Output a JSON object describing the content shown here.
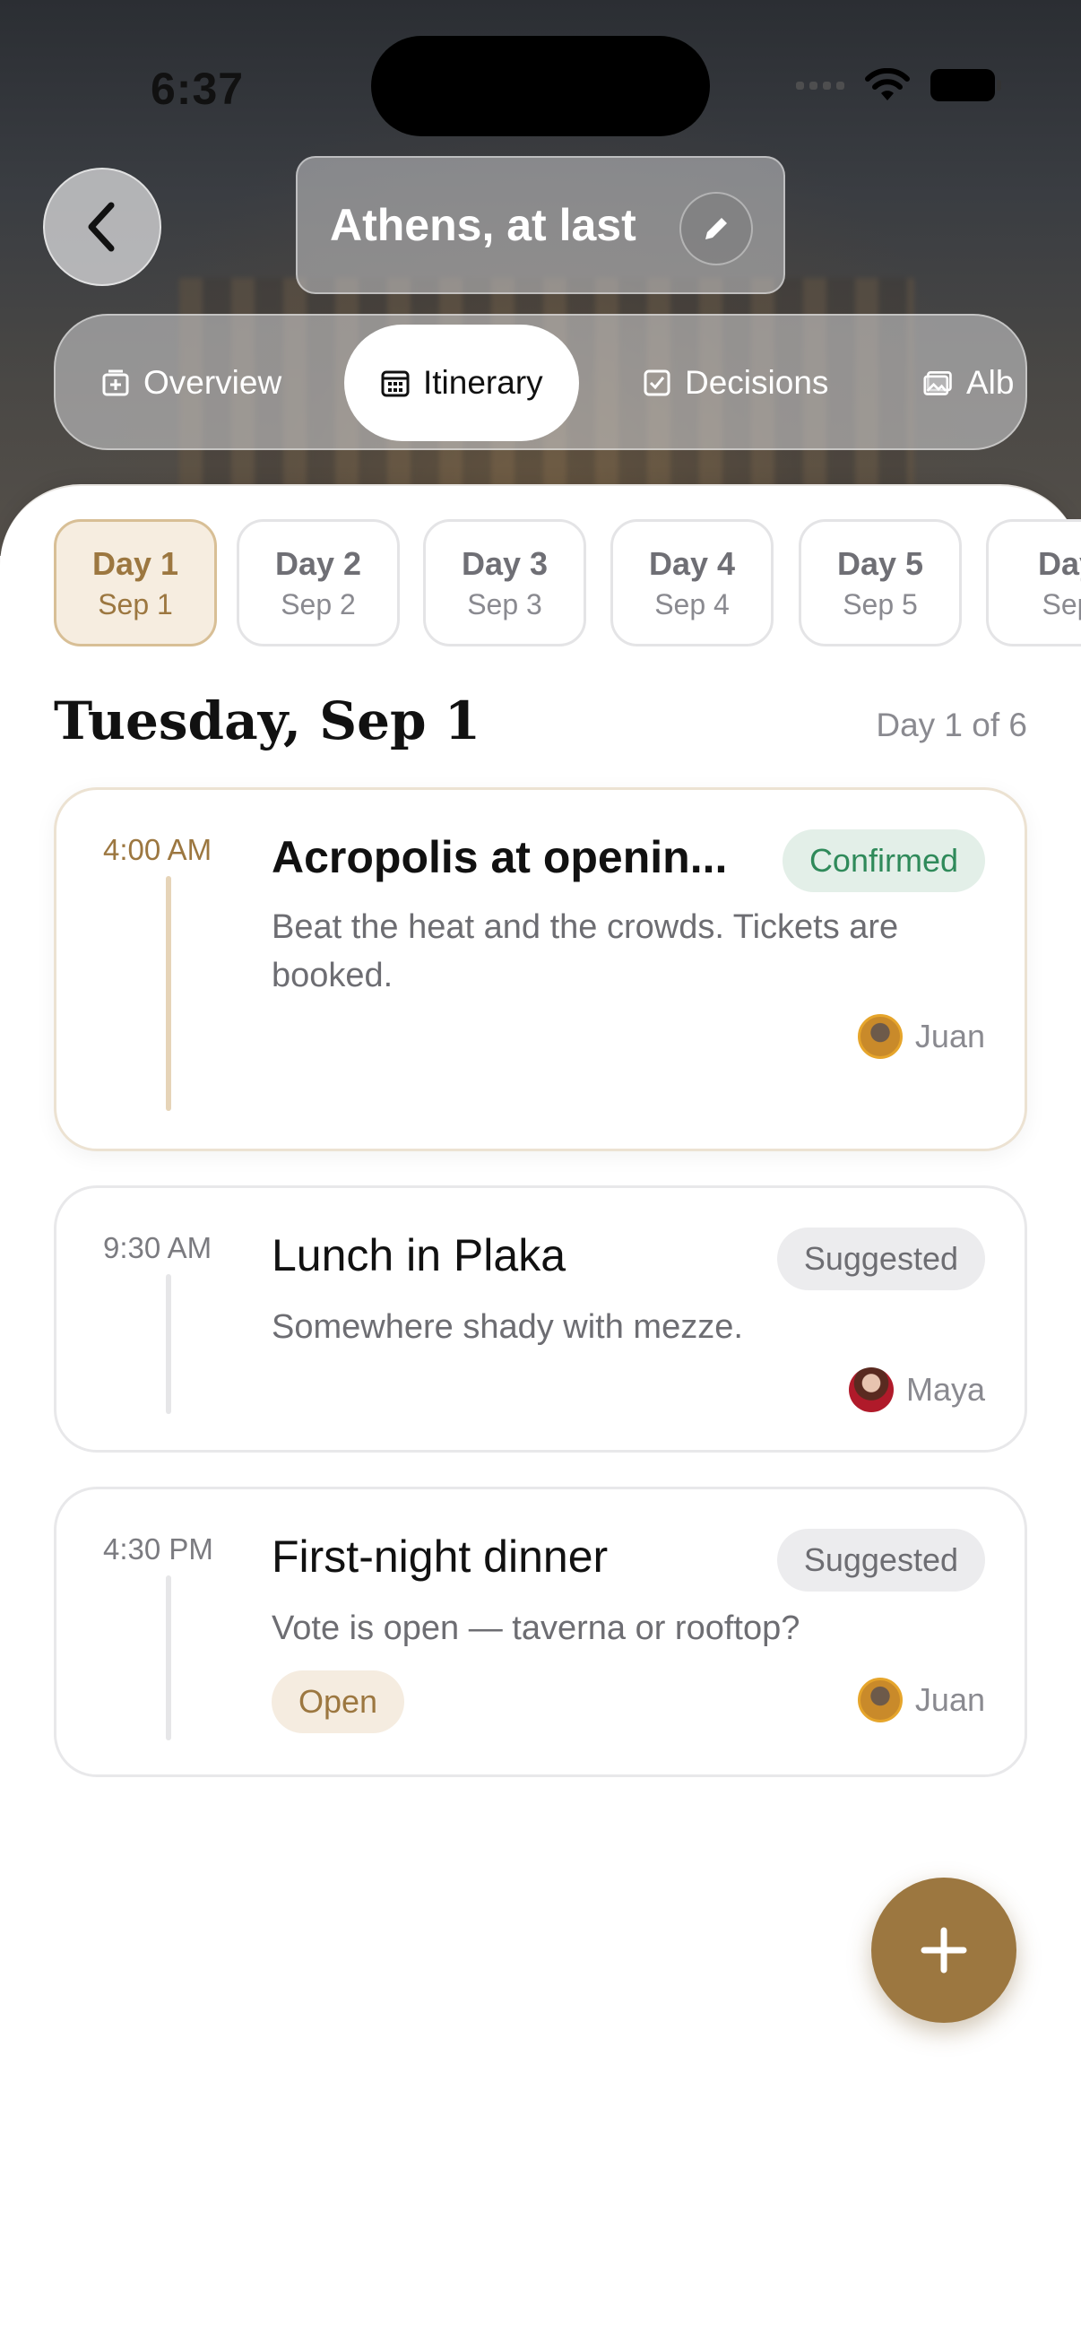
{
  "status_bar": {
    "time": "6:37"
  },
  "header": {
    "title": "Athens, at last"
  },
  "tabs": [
    {
      "label": "Overview",
      "icon": "overview-icon"
    },
    {
      "label": "Itinerary",
      "icon": "calendar-icon",
      "active": true
    },
    {
      "label": "Decisions",
      "icon": "checkbox-icon"
    },
    {
      "label": "Alb",
      "icon": "album-icon"
    }
  ],
  "days": [
    {
      "label": "Day 1",
      "date": "Sep 1",
      "active": true
    },
    {
      "label": "Day 2",
      "date": "Sep 2"
    },
    {
      "label": "Day 3",
      "date": "Sep 3"
    },
    {
      "label": "Day 4",
      "date": "Sep 4"
    },
    {
      "label": "Day 5",
      "date": "Sep 5"
    },
    {
      "label": "Day",
      "date": "Sep"
    }
  ],
  "day_heading": "Tuesday, Sep 1",
  "day_count": "Day 1 of 6",
  "items": [
    {
      "time": "4:00 AM",
      "title": "Acropolis at openin...",
      "status": "Confirmed",
      "description": "Beat the heat and the crowds. Tickets are booked.",
      "owner": "Juan"
    },
    {
      "time": "9:30 AM",
      "title": "Lunch in Plaka",
      "status": "Suggested",
      "description": "Somewhere shady with mezze.",
      "owner": "Maya"
    },
    {
      "time": "4:30 PM",
      "title": "First-night dinner",
      "status": "Suggested",
      "description": "Vote is open — taverna or rooftop?",
      "tag": "Open",
      "owner": "Juan"
    }
  ],
  "colors": {
    "accent": "#9c7740",
    "confirmed": "#2f8a5a",
    "accent_bg": "#f6ede0"
  }
}
